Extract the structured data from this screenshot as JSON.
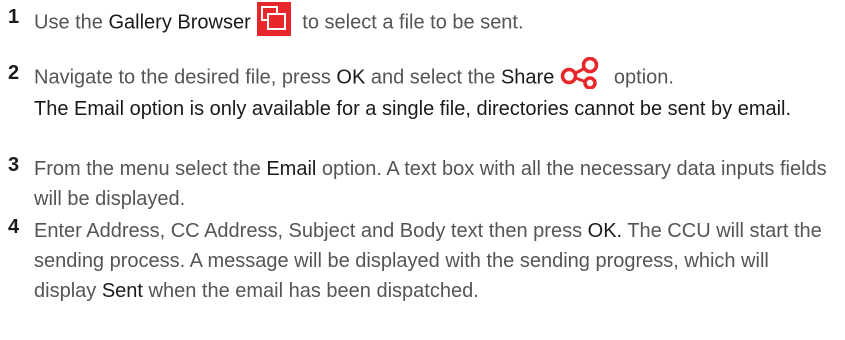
{
  "steps": [
    {
      "number": "1",
      "parts": {
        "a": "Use the ",
        "kw1": "Gallery Browser",
        "b": " to select a file to be sent."
      }
    },
    {
      "number": "2",
      "parts": {
        "a": "Navigate to the desired file, press ",
        "kw1": "OK",
        "b": " and select the ",
        "kw2": "Share",
        "c": " option.",
        "note": "The Email option is only available for a single file, directories cannot be sent by email."
      }
    },
    {
      "number": "3",
      "parts": {
        "a": "From the menu select the ",
        "kw1": "Email",
        "b": " option. A text box with all the necessary data inputs fields will be displayed."
      }
    },
    {
      "number": "4",
      "parts": {
        "a": "Enter Address, CC Address, Subject and Body text then press ",
        "kw1": "OK.",
        "b": "  The CCU will start the sending process. A message will be displayed with the sending progress, which will display ",
        "kw2": "Sent",
        "c": " when the email has been dispatched."
      }
    }
  ],
  "icons": {
    "gallery": "gallery-browser-icon",
    "share": "share-icon",
    "accent": "#e8272a"
  }
}
